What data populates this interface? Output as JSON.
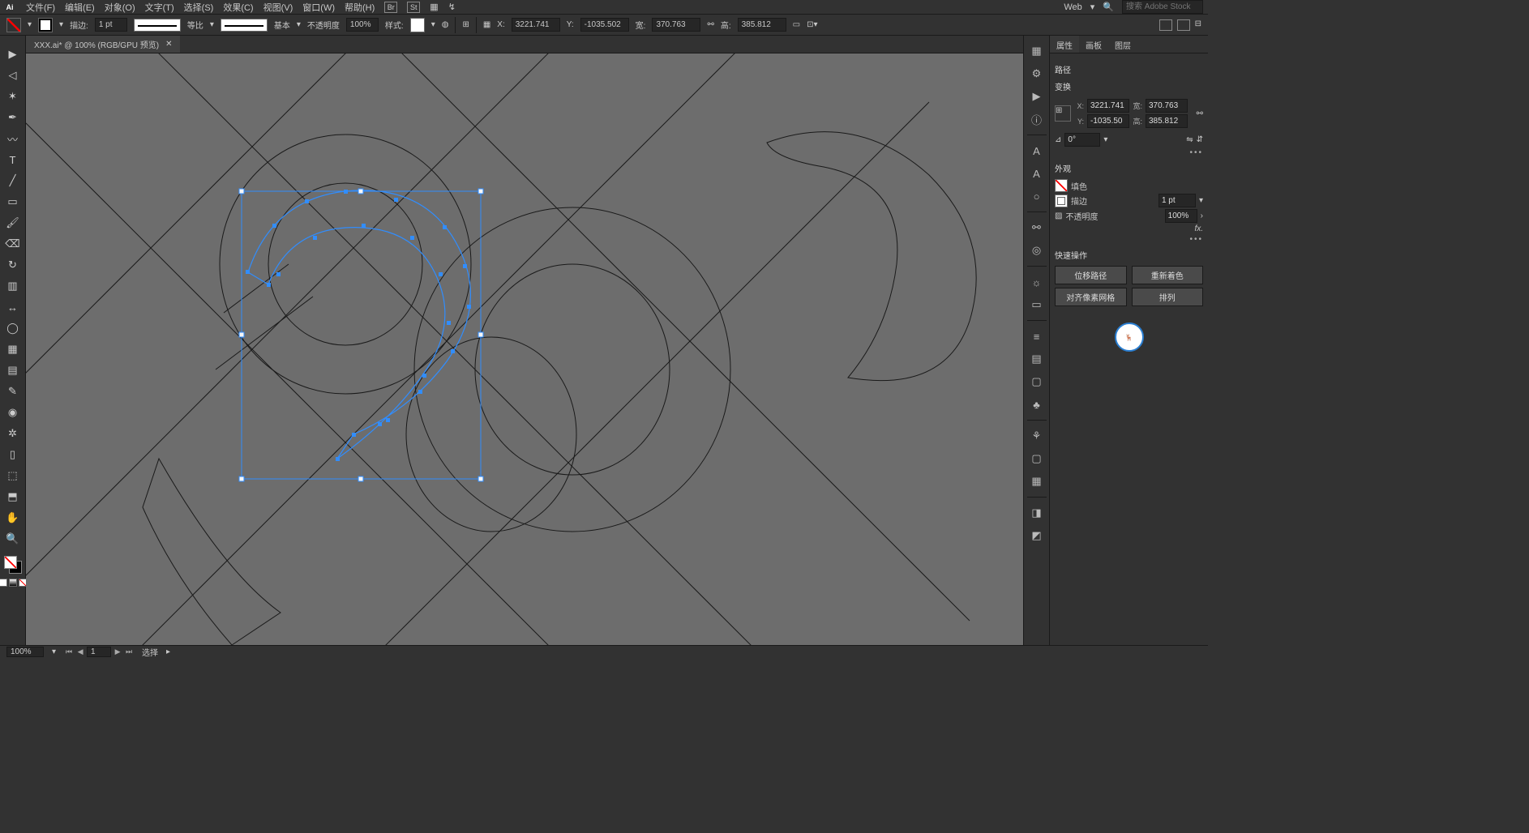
{
  "menu": {
    "app_icon": "Ai",
    "items": [
      "文件(F)",
      "编辑(E)",
      "对象(O)",
      "文字(T)",
      "选择(S)",
      "效果(C)",
      "视图(V)",
      "窗口(W)",
      "帮助(H)"
    ],
    "workspace_preset": "Web",
    "search_placeholder": "搜索 Adobe Stock"
  },
  "control": {
    "stroke_label": "描边:",
    "stroke_value": "1 pt",
    "profile_label": "等比",
    "brush_label": "基本",
    "opacity_label": "不透明度",
    "opacity_value": "100%",
    "style_label": "样式:",
    "x_label": "X:",
    "x_value": "3221.741",
    "y_label": "Y:",
    "y_value": "-1035.502",
    "w_label": "宽:",
    "w_value": "370.763",
    "h_label": "高:",
    "h_value": "385.812"
  },
  "tab": {
    "title": "XXX.ai* @ 100% (RGB/GPU 预览)"
  },
  "tools": {
    "icons": [
      "selection",
      "direct-select",
      "magic-wand",
      "pen",
      "curvature",
      "text",
      "line",
      "rectangle",
      "paintbrush",
      "eraser",
      "rotate",
      "scale",
      "width",
      "shape-builder",
      "mesh",
      "gradient",
      "eyedropper",
      "blend",
      "symbol-sprayer",
      "column-graph",
      "artboard",
      "slice",
      "hand",
      "zoom"
    ],
    "glyphs": [
      "▶",
      "◁",
      "✶",
      "✒",
      "〰",
      "T",
      "╱",
      "▭",
      "🖌",
      "⌫",
      "↻",
      "▥",
      "↔",
      "◯",
      "▦",
      "▤",
      "✎",
      "◉",
      "✲",
      "▯",
      "⬚",
      "⬒",
      "✋",
      "🔍"
    ]
  },
  "dock": {
    "icons": [
      "library",
      "settings",
      "play",
      "info",
      "type",
      "type2",
      "ellipse",
      "link",
      "cc-lib",
      "mask",
      "grid-snap",
      "align",
      "pathfinder",
      "brushes",
      "symbols",
      "graphic-styles",
      "swatches",
      "image-trace",
      "transparency",
      "stroke-panel"
    ],
    "glyphs": [
      "▦",
      "⚙",
      "▶",
      "ⓘ",
      "A",
      "A",
      "○",
      "⚯",
      "◎",
      "☼",
      "▭",
      "≡",
      "▤",
      "▢",
      "♣",
      "⚘",
      "▢",
      "▦",
      "◨",
      "◩",
      "◪"
    ]
  },
  "props": {
    "tabs": [
      "属性",
      "画板",
      "图层"
    ],
    "obj_type": "路径",
    "transform_title": "变换",
    "x_label": "X:",
    "x_value": "3221.741",
    "y_label": "Y:",
    "y_value": "-1035.50",
    "w_label": "宽:",
    "w_value": "370.763",
    "h_label": "高:",
    "h_value": "385.812",
    "angle_label": "⊿",
    "angle_value": "0°",
    "appear_title": "外观",
    "fill_label": "填色",
    "stroke_label": "描边",
    "stroke_value": "1 pt",
    "opacity_label": "不透明度",
    "opacity_value": "100%",
    "quick_title": "快速操作",
    "btn_offset": "位移路径",
    "btn_recolor": "重新着色",
    "btn_pixel": "对齐像素网格",
    "btn_arrange": "排列"
  },
  "status": {
    "zoom": "100%",
    "page": "1",
    "mode": "选择"
  }
}
